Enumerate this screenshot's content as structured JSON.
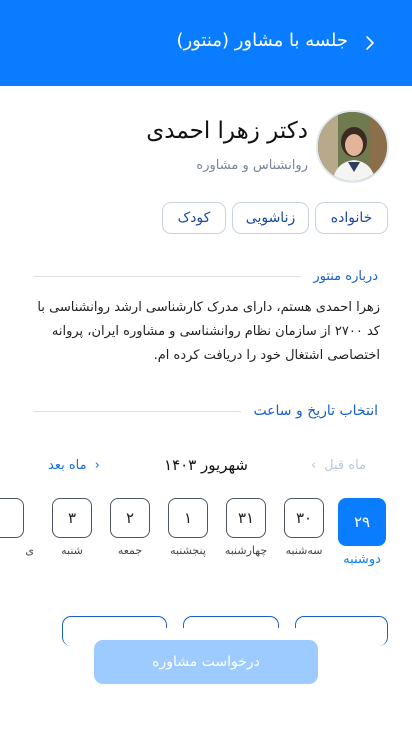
{
  "header": {
    "title": "جلسه با مشاور (منتور)",
    "back_icon": "chevron-right-icon",
    "background": "#0a7cff"
  },
  "mentor": {
    "name": "دکتر زهرا احمدی",
    "role": "روانشناس و مشاوره",
    "tags": [
      "خانواده",
      "زناشویی",
      "کودک"
    ]
  },
  "about": {
    "title": "درباره منتور",
    "text": "زهرا احمدی هستم، دارای مدرک کارشناسی ارشد روانشناسی با کد ۲۷۰۰ از سازمان نظام روانشناسی و مشاوره ایران، پروانه اختصاصی اشتغال خود را دریافت کرده ام."
  },
  "schedule": {
    "title": "انتخاب تاریخ و ساعت",
    "month": "شهریور ۱۴۰۳",
    "next_label": "ماه بعد",
    "prev_label": "ماه قبل",
    "days": [
      {
        "num": "۲۹",
        "name": "دوشنبه",
        "selected": true
      },
      {
        "num": "۳۰",
        "name": "سه‌شنبه"
      },
      {
        "num": "۳۱",
        "name": "چهارشنبه"
      },
      {
        "num": "۱",
        "name": "پنجشنبه"
      },
      {
        "num": "۲",
        "name": "جمعه"
      },
      {
        "num": "۳",
        "name": "شنبه"
      },
      {
        "num": "",
        "name": "ی"
      }
    ]
  },
  "action": {
    "submit_label": "درخواست مشاوره"
  },
  "colors": {
    "accent": "#0a7cff",
    "disabled_button": "#9ecbff"
  }
}
